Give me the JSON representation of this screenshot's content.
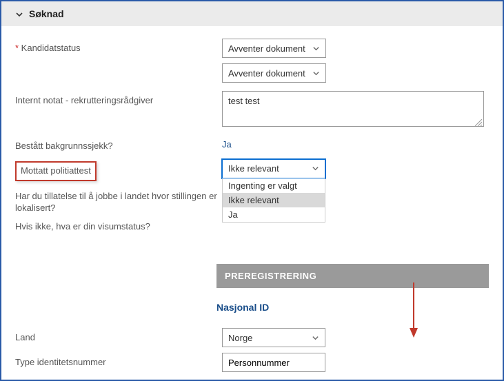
{
  "section": {
    "title": "Søknad"
  },
  "fields": {
    "kandidatstatus": {
      "label": "Kandidatstatus",
      "value1": "Avventer dokument",
      "value2": "Avventer dokument"
    },
    "internt_notat": {
      "label": "Internt notat - rekrutteringsrådgiver",
      "value": "test test"
    },
    "bakgrunnssjekk": {
      "label": "Bestått bakgrunnssjekk?",
      "value": "Ja"
    },
    "politiattest": {
      "label": "Mottatt politiattest",
      "value": "Ikke relevant",
      "options": [
        "Ingenting er valgt",
        "Ikke relevant",
        "Ja"
      ]
    },
    "tillatelse": {
      "label": "Har du tillatelse til å jobbe i landet hvor stillingen er lokalisert?"
    },
    "visumstatus": {
      "label": "Hvis ikke, hva er din visumstatus?"
    },
    "preregistrering": {
      "title": "PREREGISTRERING"
    },
    "nasjonal_id": {
      "title": "Nasjonal ID"
    },
    "land": {
      "label": "Land",
      "value": "Norge"
    },
    "type_id": {
      "label": "Type identitetsnummer",
      "value": "Personnummer"
    }
  }
}
